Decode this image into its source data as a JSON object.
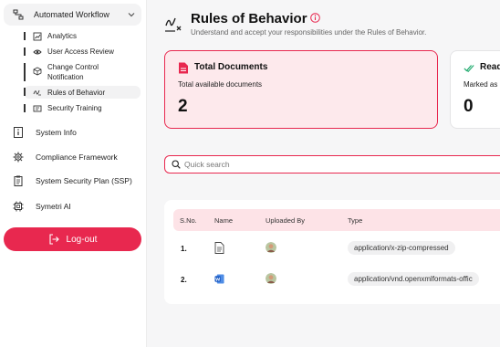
{
  "sidebar": {
    "workflow_label": "Automated Workflow",
    "sub_items": [
      {
        "label": "Analytics",
        "icon": "chart-icon"
      },
      {
        "label": "User Access Review",
        "icon": "eye-icon"
      },
      {
        "label": "Change Control Notification",
        "icon": "cube-icon"
      },
      {
        "label": "Rules of Behavior",
        "icon": "signature-icon",
        "active": true
      },
      {
        "label": "Security Training",
        "icon": "training-icon"
      }
    ],
    "main_items": [
      {
        "label": "System Info",
        "icon": "info-box-icon"
      },
      {
        "label": "Compliance Framework",
        "icon": "gear-icon"
      },
      {
        "label": "System Security Plan (SSP)",
        "icon": "clipboard-icon"
      },
      {
        "label": "Symetri AI",
        "icon": "chip-icon"
      }
    ],
    "logout_label": "Log-out"
  },
  "header": {
    "title": "Rules of Behavior",
    "subtitle": "Understand and accept your responsibilities under the Rules of Behavior."
  },
  "cards": [
    {
      "title": "Total Documents",
      "subtitle": "Total available documents",
      "value": "2",
      "icon": "document-icon"
    },
    {
      "title": "Read",
      "subtitle": "Marked as",
      "value": "0",
      "icon": "double-check-icon"
    }
  ],
  "search": {
    "placeholder": "Quick search",
    "value": ""
  },
  "table": {
    "columns": [
      "S.No.",
      "Name",
      "Uploaded By",
      "Type"
    ],
    "rows": [
      {
        "sno": "1.",
        "file_icon": "zip-file-icon",
        "type": "application/x-zip-compressed"
      },
      {
        "sno": "2.",
        "file_icon": "word-file-icon",
        "type": "application/vnd.openxmlformats-offic"
      }
    ]
  },
  "colors": {
    "accent": "#e8284f",
    "accent_light": "#fde9ec"
  }
}
